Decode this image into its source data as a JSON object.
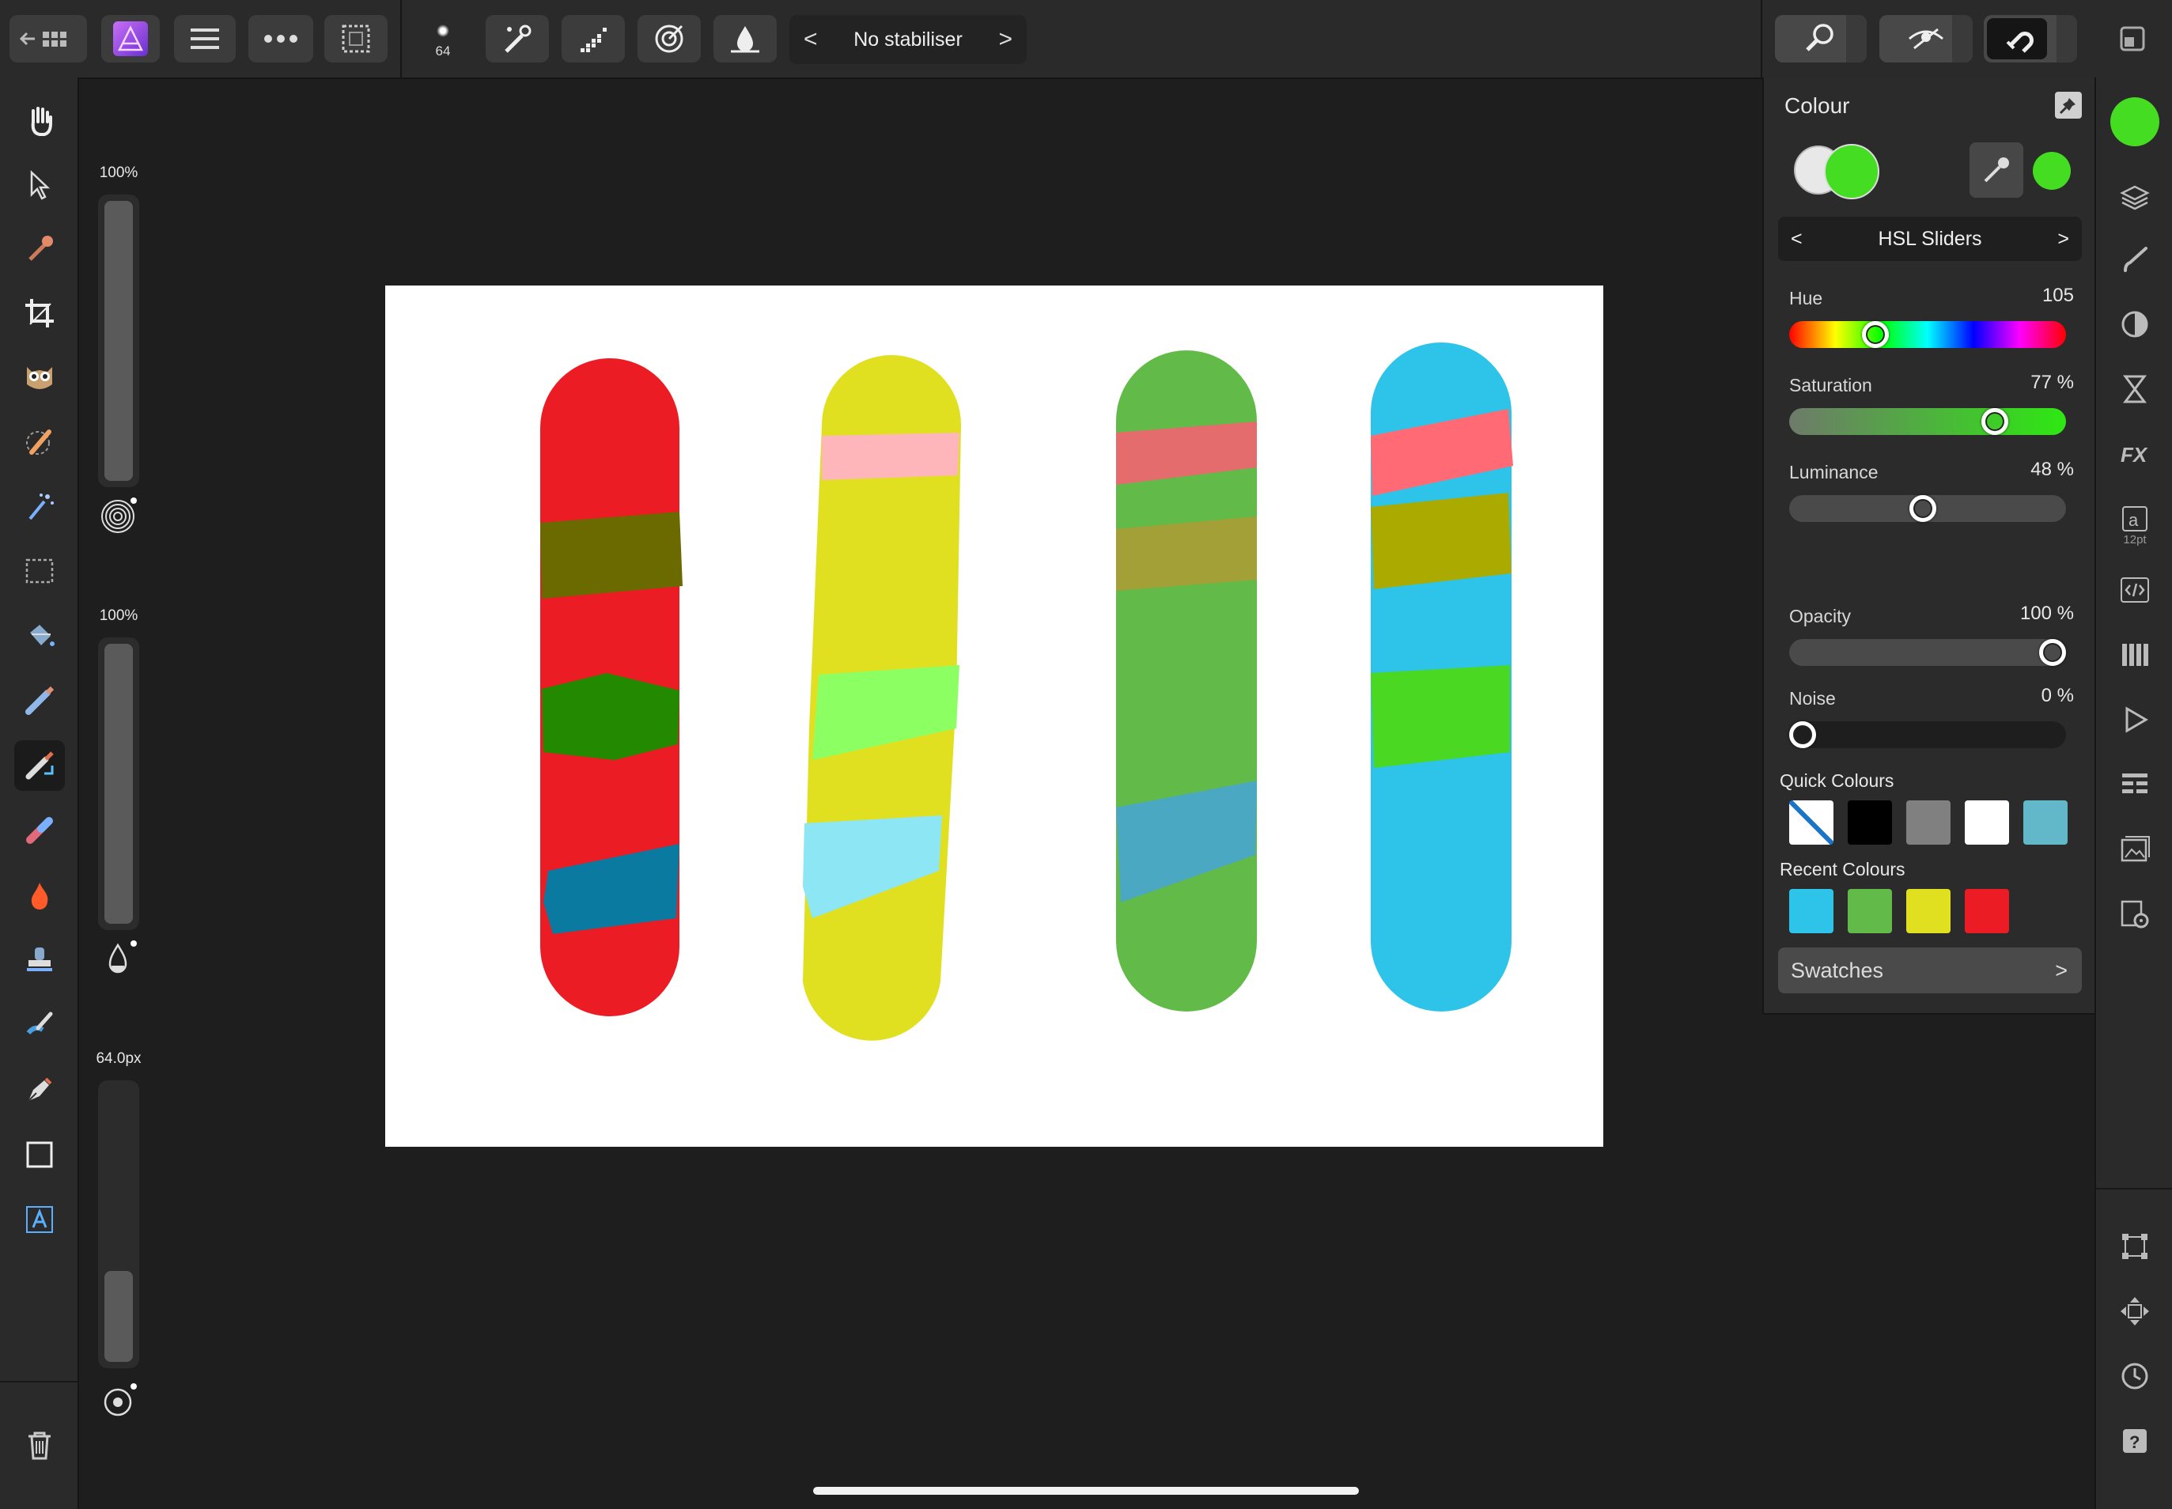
{
  "toolbar": {
    "brush_size_value": "64",
    "stabiliser_label": "No stabiliser",
    "stabiliser_prev": "<",
    "stabiliser_next": ">"
  },
  "context_sliders": {
    "opacity_label": "100%",
    "opacity_fraction": 1.0,
    "flow_label": "100%",
    "flow_fraction": 1.0,
    "width_label": "64.0px",
    "width_fraction": 0.33
  },
  "colour_panel": {
    "title": "Colour",
    "primary_color": "#44dd22",
    "secondary_color": "#e8e8e8",
    "mode": "HSL Sliders",
    "mode_prev": "<",
    "mode_next": ">",
    "hue": {
      "label": "Hue",
      "value": "105",
      "fraction": 0.29
    },
    "saturation": {
      "label": "Saturation",
      "value": "77 %",
      "fraction": 0.77
    },
    "luminance": {
      "label": "Luminance",
      "value": "48 %",
      "fraction": 0.48
    },
    "opacity": {
      "label": "Opacity",
      "value": "100 %",
      "fraction": 1.0
    },
    "noise": {
      "label": "Noise",
      "value": "0 %",
      "fraction": 0.0
    },
    "quick_colours_label": "Quick Colours",
    "quick_colours": [
      "none",
      "#000000",
      "#808080",
      "#ffffff",
      "#62b8c8"
    ],
    "recent_colours_label": "Recent Colours",
    "recent_colours": [
      "#2ec4ea",
      "#62bb48",
      "#e0e020",
      "#ec1c24"
    ],
    "swatches_label": "Swatches",
    "swatches_arrow": ">"
  },
  "studio": {
    "current_color": "#44dd22",
    "text_style_size": "12pt"
  },
  "canvas": {
    "background": "#ffffff",
    "strokes": [
      {
        "base": "#ec1c24",
        "bands": [
          "#6b6a00",
          "#238a00",
          "#0a7aa0"
        ]
      },
      {
        "base": "#e0e020",
        "bands": [
          "#ffb6ba",
          "#8cff62",
          "#8ce6f4"
        ]
      },
      {
        "base": "#62bb48",
        "bands": [
          "#e46c6c",
          "#a2a036",
          "#4aa8c2"
        ]
      },
      {
        "base": "#2ec4ea",
        "bands": [
          "#ff6a74",
          "#aaaa00",
          "#4ad822"
        ]
      }
    ]
  }
}
